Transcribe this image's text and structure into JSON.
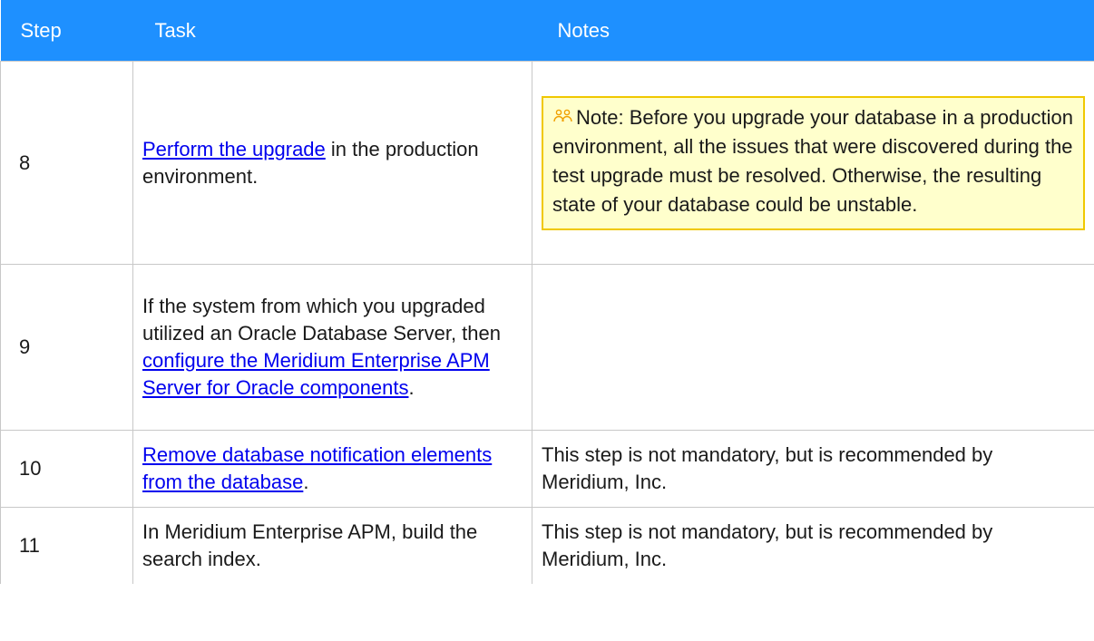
{
  "header": {
    "step": "Step",
    "task": "Task",
    "notes": "Notes"
  },
  "rows": [
    {
      "step": "8",
      "task": {
        "link": "Perform the upgrade",
        "text": " in the production environment."
      },
      "notes": {
        "label": "Note:",
        "text": " Before you upgrade your database in a production environment, all the issues that were discovered during the test upgrade must be resolved. Otherwise, the resulting state of your database could be unstable.",
        "icon": "people-icon"
      }
    },
    {
      "step": "9",
      "task": {
        "text_before": "If the system from which you upgraded utilized an Oracle Database Server, then ",
        "link": "configure the Meridium Enterprise APM Server for Oracle components",
        "text_after": "."
      },
      "notes": ""
    },
    {
      "step": "10",
      "task": {
        "link": "Remove database notification elements from the database",
        "text_after": "."
      },
      "notes": "This step is not mandatory, but is recommended by Meridium, Inc."
    },
    {
      "step": "11",
      "task": {
        "text": "In Meridium Enterprise APM, build the search index."
      },
      "notes": "This step is not mandatory, but is recommended by Meridium, Inc."
    }
  ],
  "colors": {
    "header_bg": "#1e90ff",
    "link": "#0000ee",
    "note_bg": "#ffffcc",
    "note_border": "#f0c800",
    "note_icon": "#f0a000"
  }
}
